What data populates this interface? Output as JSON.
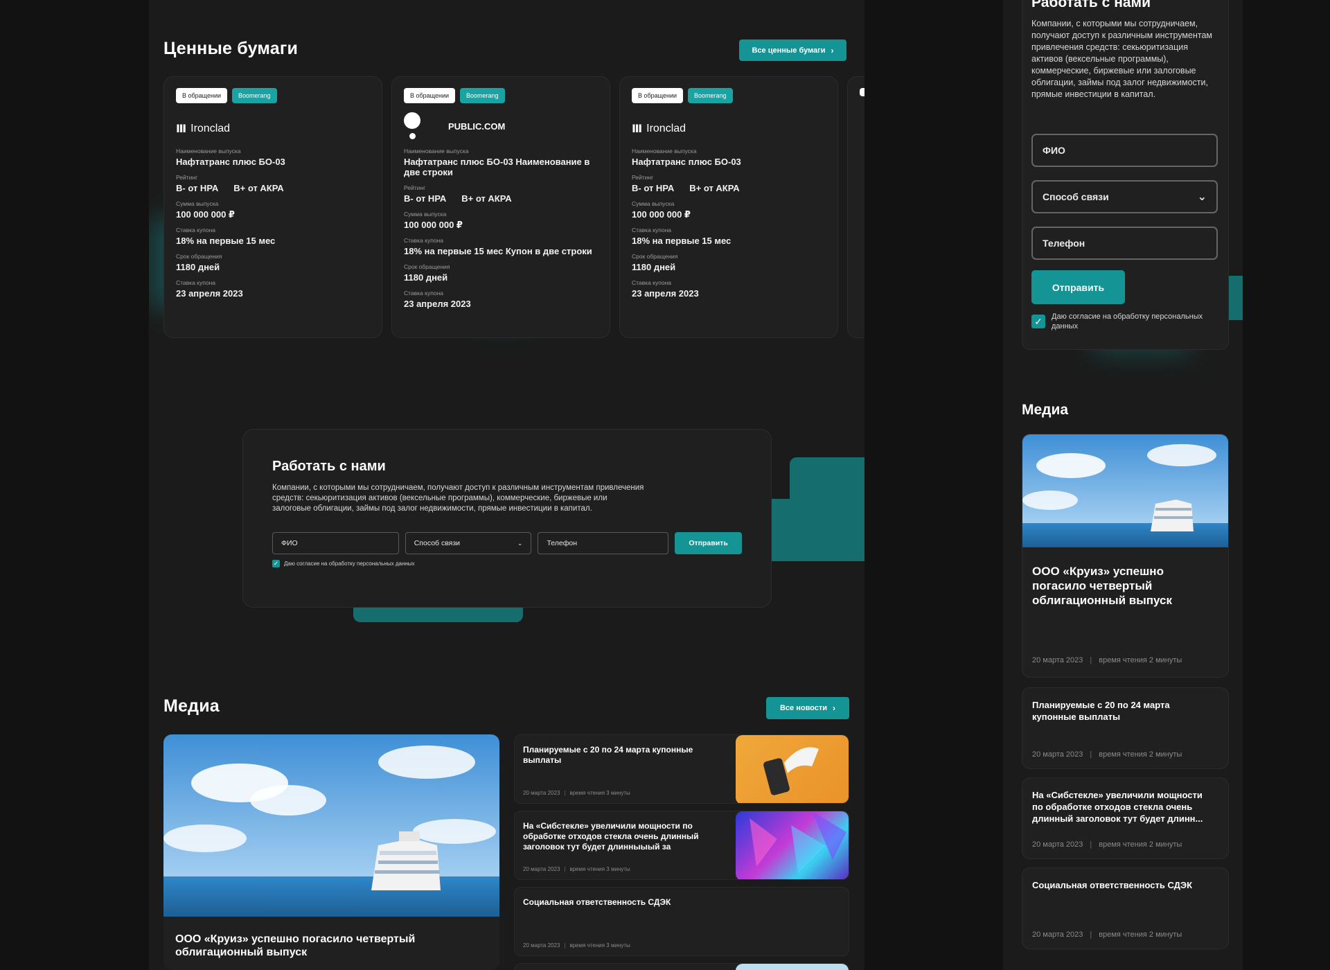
{
  "securities": {
    "title": "Ценные бумаги",
    "all_button": "Все ценные бумаги",
    "cards": [
      {
        "badge1": "В обращении",
        "badge2": "Boomerang",
        "logo": "Ironclad",
        "name_label": "Наименование выпуска",
        "name": "Нафтатранс плюс БО-03",
        "rating_label": "Рейтинг",
        "rating1": "B- от НРА",
        "rating2": "B+ от АКРА",
        "sum_label": "Сумма выпуска",
        "sum": "100 000 000 ₽",
        "coupon_label": "Ставка купона",
        "coupon": "18% на первые 15 мес",
        "term_label": "Срок обращения",
        "term": "1180 дней",
        "date_label": "Ставка купона",
        "date": "23 апреля 2023"
      },
      {
        "badge1": "В обращении",
        "badge2": "Boomerang",
        "logo": "PUBLIC.COM",
        "name_label": "Наименование выпуска",
        "name": "Нафтатранс плюс БО-03 Наименование в две строки",
        "rating_label": "Рейтинг",
        "rating1": "B- от НРА",
        "rating2": "B+ от АКРА",
        "sum_label": "Сумма выпуска",
        "sum": "100 000 000 ₽",
        "coupon_label": "Ставка купона",
        "coupon": "18% на первые 15 мес Купон в две строки",
        "term_label": "Срок обращения",
        "term": "1180 дней",
        "date_label": "Ставка купона",
        "date": "23 апреля 2023"
      },
      {
        "badge1": "В обращении",
        "badge2": "Boomerang",
        "logo": "Ironclad",
        "name_label": "Наименование выпуска",
        "name": "Нафтатранс плюс БО-03",
        "rating_label": "Рейтинг",
        "rating1": "B- от НРА",
        "rating2": "B+ от АКРА",
        "sum_label": "Сумма выпуска",
        "sum": "100 000 000 ₽",
        "coupon_label": "Ставка купона",
        "coupon": "18% на первые 15 мес",
        "term_label": "Срок обращения",
        "term": "1180 дней",
        "date_label": "Ставка купона",
        "date": "23 апреля 2023"
      }
    ]
  },
  "work": {
    "title": "Работать с нами",
    "text": "Компании, с которыми мы сотрудничаем, получают доступ к различным инструментам привлечения средств: секьюритизация активов (вексельные программы), коммерческие, биржевые или залоговые облигации, займы под залог недвижимости, прямые инвестиции в капитал.",
    "fio": "ФИО",
    "contact": "Способ связи",
    "phone": "Телефон",
    "send": "Отправить",
    "consent": "Даю согласие на обработку персональных данных"
  },
  "media": {
    "title": "Медиа",
    "all_button": "Все новости",
    "featured": "ООО «Круиз» успешно погасило четвертый облигационный выпуск",
    "news": [
      {
        "title": "Планируемые с 20 по 24 марта купонные выплаты",
        "date": "20 марта 2023",
        "read": "время чтения 3 минуты"
      },
      {
        "title": "На «Сибстекле» увеличили мощности по обработке отходов стекла очень длинный заголовок тут будет длинныыый за",
        "date": "20 марта 2023",
        "read": "время чтения 3 минуты"
      },
      {
        "title": "Социальная ответственность СДЭК",
        "date": "20 марта 2023",
        "read": "время чтения 3 минуты"
      }
    ]
  },
  "mobile": {
    "work_title": "Работать с нами",
    "work_text": "Компании, с которыми мы сотрудничаем, получают доступ к различным инструментам привлечения средств: секьюритизация активов (вексельные программы), коммерческие, биржевые или залоговые облигации, займы под залог недвижимости, прямые инвестиции в капитал.",
    "fio": "ФИО",
    "contact": "Способ связи",
    "phone": "Телефон",
    "send": "Отправить",
    "consent": "Даю согласие на обработку персональных данных",
    "media_title": "Медиа",
    "featured": "ООО «Круиз» успешно погасило четвертый облигационный выпуск",
    "featured_date": "20 марта 2023",
    "featured_read": "время чтения 2 минуты",
    "news": [
      {
        "title": "Планируемые с 20 по 24 марта купонные выплаты",
        "date": "20 марта 2023",
        "read": "время чтения 2 минуты"
      },
      {
        "title": "На «Сибстекле» увеличили мощности по обработке отходов стекла очень длинный заголовок тут будет длинн...",
        "date": "20 марта 2023",
        "read": "время чтения 2 минуты"
      },
      {
        "title": "Социальная ответственность СДЭК",
        "date": "20 марта 2023",
        "read": "время чтения 2 минуты"
      }
    ]
  },
  "colors": {
    "accent": "#149494",
    "background": "#121212",
    "card": "#202020"
  },
  "icons": {
    "chevron": "chevron-right-icon",
    "dropdown": "chevron-down-icon",
    "check": "check-icon",
    "ironclad": "ironclad-logo-icon"
  }
}
